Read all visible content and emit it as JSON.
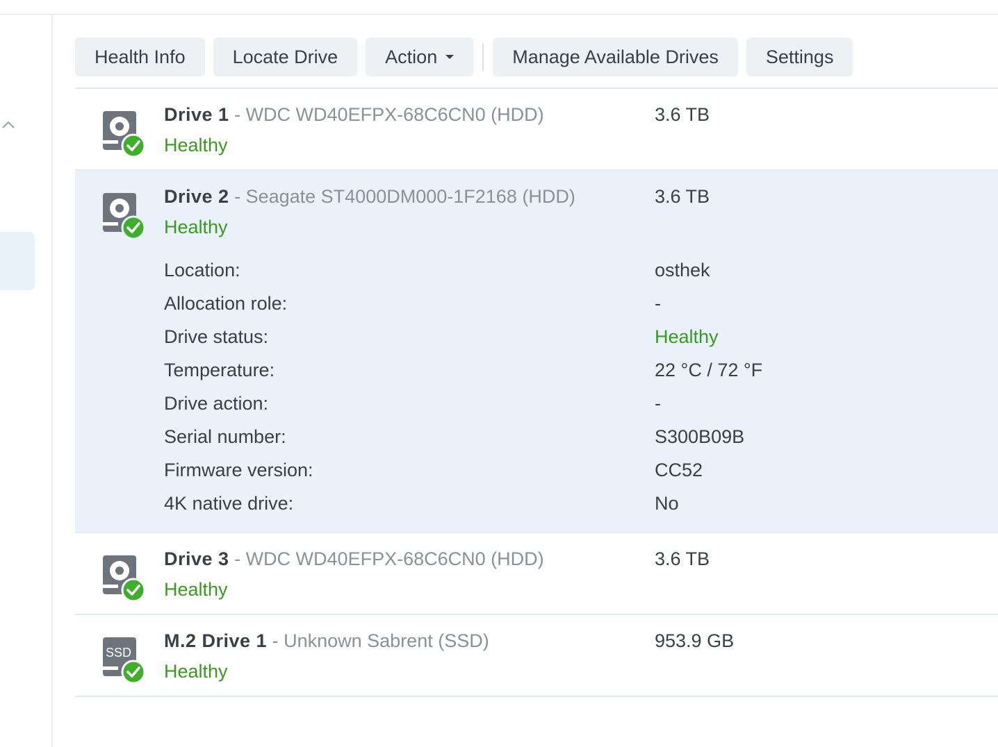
{
  "toolbar": {
    "health_info": "Health Info",
    "locate_drive": "Locate Drive",
    "action": "Action",
    "manage_drives": "Manage Available Drives",
    "settings": "Settings"
  },
  "drives": [
    {
      "name": "Drive 1",
      "model": "- WDC WD40EFPX-68C6CN0 (HDD)",
      "status": "Healthy",
      "size": "3.6 TB",
      "icon": "hdd-icon"
    },
    {
      "name": "Drive 2",
      "model": "- Seagate ST4000DM000-1F2168 (HDD)",
      "status": "Healthy",
      "size": "3.6 TB",
      "icon": "hdd-icon",
      "details": [
        {
          "label": "Location:",
          "value": "osthek"
        },
        {
          "label": "Allocation role:",
          "value": "-"
        },
        {
          "label": "Drive status:",
          "value": "Healthy"
        },
        {
          "label": "Temperature:",
          "value": "22 °C / 72 °F"
        },
        {
          "label": "Drive action:",
          "value": "-"
        },
        {
          "label": "Serial number:",
          "value": "S300B09B"
        },
        {
          "label": "Firmware version:",
          "value": "CC52"
        },
        {
          "label": "4K native drive:",
          "value": "No"
        }
      ]
    },
    {
      "name": "Drive 3",
      "model": "- WDC WD40EFPX-68C6CN0 (HDD)",
      "status": "Healthy",
      "size": "3.6 TB",
      "icon": "hdd-icon"
    },
    {
      "name": "M.2 Drive 1",
      "model": "- Unknown Sabrent (SSD)",
      "status": "Healthy",
      "size": "953.9 GB",
      "icon": "ssd-icon",
      "icon_text": "SSD"
    }
  ],
  "colors": {
    "healthy": "#3a9a1e",
    "selected_bg": "#eaf1fb",
    "button_bg": "#eef1f4"
  }
}
